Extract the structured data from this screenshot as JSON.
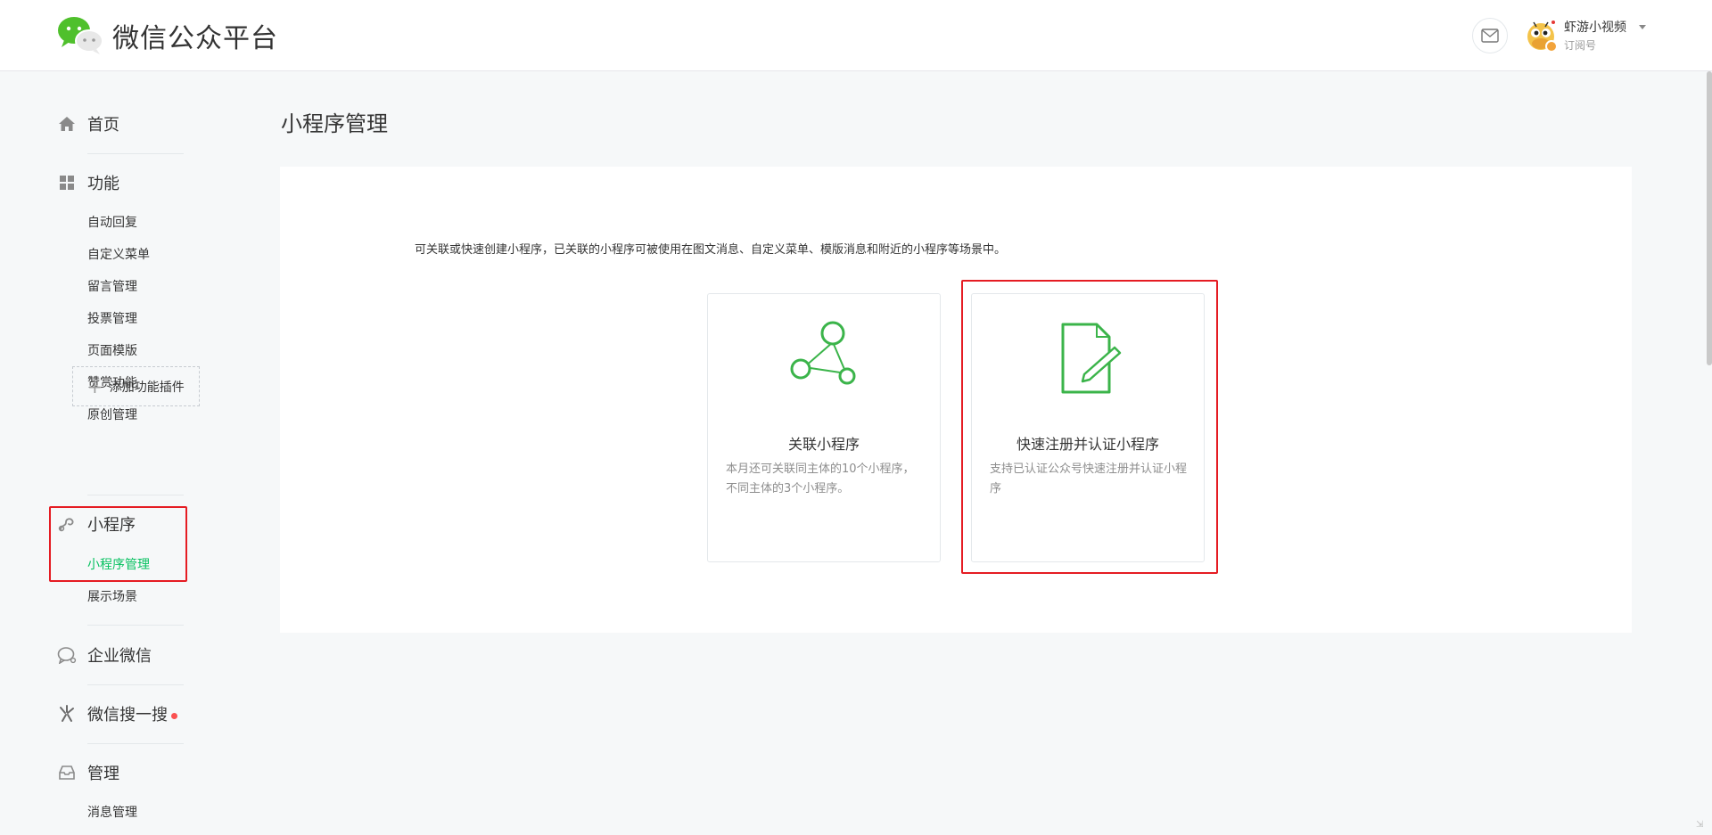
{
  "header": {
    "brand": "微信公众平台",
    "user_name": "虾游小视频",
    "user_type": "订阅号"
  },
  "sidebar": {
    "home": "首页",
    "function": {
      "label": "功能",
      "items": [
        "自动回复",
        "自定义菜单",
        "留言管理",
        "投票管理",
        "页面模版",
        "赞赏功能",
        "原创管理"
      ],
      "add_plugin": "添加功能插件"
    },
    "miniprogram": {
      "label": "小程序",
      "items": [
        "小程序管理",
        "展示场景"
      ],
      "active": "小程序管理"
    },
    "enterprise": "企业微信",
    "search": "微信搜一搜",
    "manage": {
      "label": "管理",
      "items": [
        "消息管理"
      ]
    }
  },
  "main": {
    "title": "小程序管理",
    "intro": "可关联或快速创建小程序，已关联的小程序可被使用在图文消息、自定义菜单、模版消息和附近的小程序等场景中。",
    "cards": [
      {
        "title": "关联小程序",
        "desc": "本月还可关联同主体的10个小程序，不同主体的3个小程序。"
      },
      {
        "title": "快速注册并认证小程序",
        "desc": "支持已认证公众号快速注册并认证小程序"
      }
    ]
  },
  "colors": {
    "accent": "#07c160",
    "icon_green": "#3bb44a",
    "highlight": "#e51c23"
  }
}
